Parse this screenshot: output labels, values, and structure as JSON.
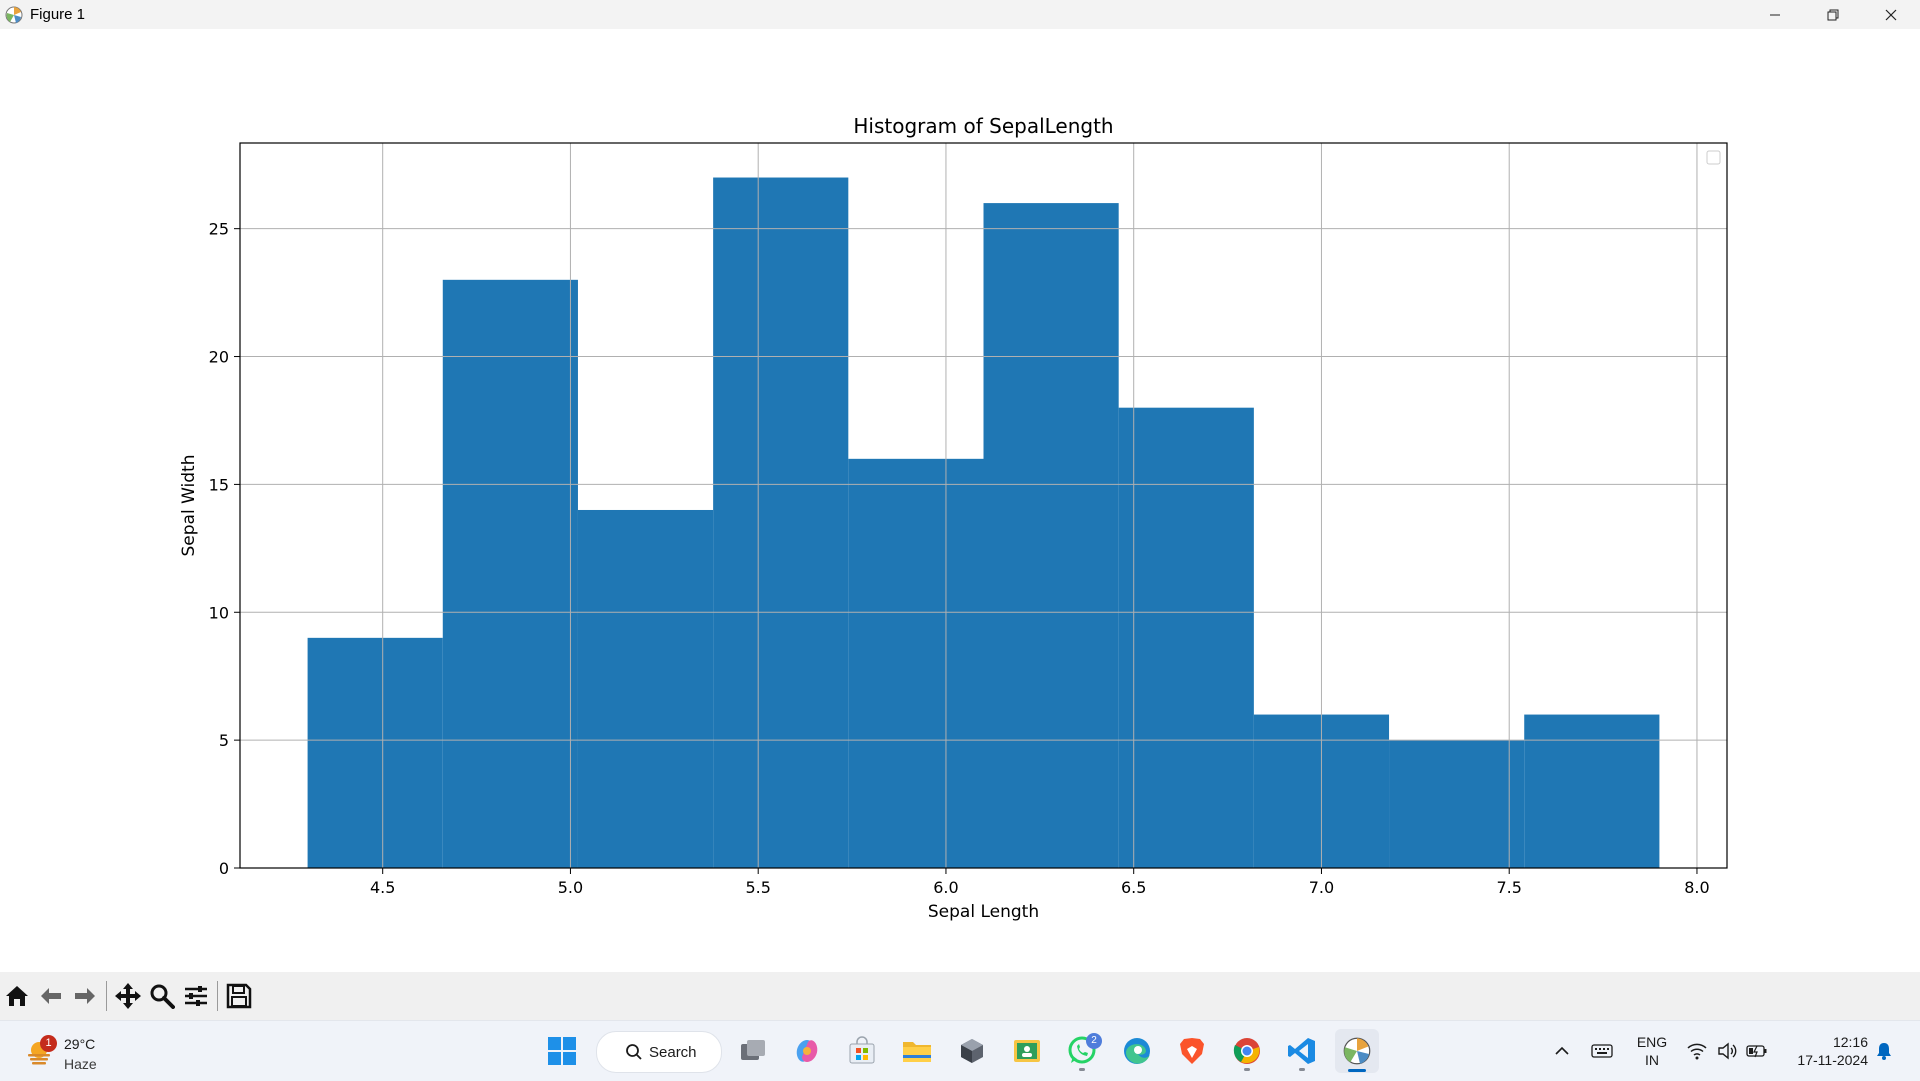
{
  "window": {
    "title": "Figure 1"
  },
  "chart_data": {
    "type": "bar",
    "title": "Histogram of SepalLength",
    "xlabel": "Sepal Length",
    "ylabel": "Sepal Width",
    "bin_edges": [
      4.3,
      4.66,
      5.02,
      5.38,
      5.74,
      6.1,
      6.46,
      6.82,
      7.18,
      7.54,
      7.9
    ],
    "values": [
      9,
      23,
      14,
      27,
      16,
      26,
      18,
      6,
      5,
      6
    ],
    "xlim": [
      4.12,
      8.08
    ],
    "ylim": [
      0,
      28.35
    ],
    "xticks": [
      "4.5",
      "5.0",
      "5.5",
      "6.0",
      "6.5",
      "7.0",
      "7.5",
      "8.0"
    ],
    "yticks": [
      "0",
      "5",
      "10",
      "15",
      "20",
      "25"
    ],
    "grid": true,
    "legend": "top-right (empty)",
    "bar_color": "#1f77b4"
  },
  "toolbar": {
    "buttons": [
      "home-icon",
      "back-icon",
      "forward-icon",
      "pan-icon",
      "zoom-icon",
      "configure-subplots-icon",
      "save-icon"
    ]
  },
  "taskbar": {
    "weather": {
      "temperature": "29°C",
      "condition": "Haze",
      "badge": "1"
    },
    "search_label": "Search",
    "whatsapp_badge": "2",
    "language": {
      "line1": "ENG",
      "line2": "IN"
    },
    "clock": {
      "time": "12:16",
      "date": "17-11-2024"
    }
  }
}
